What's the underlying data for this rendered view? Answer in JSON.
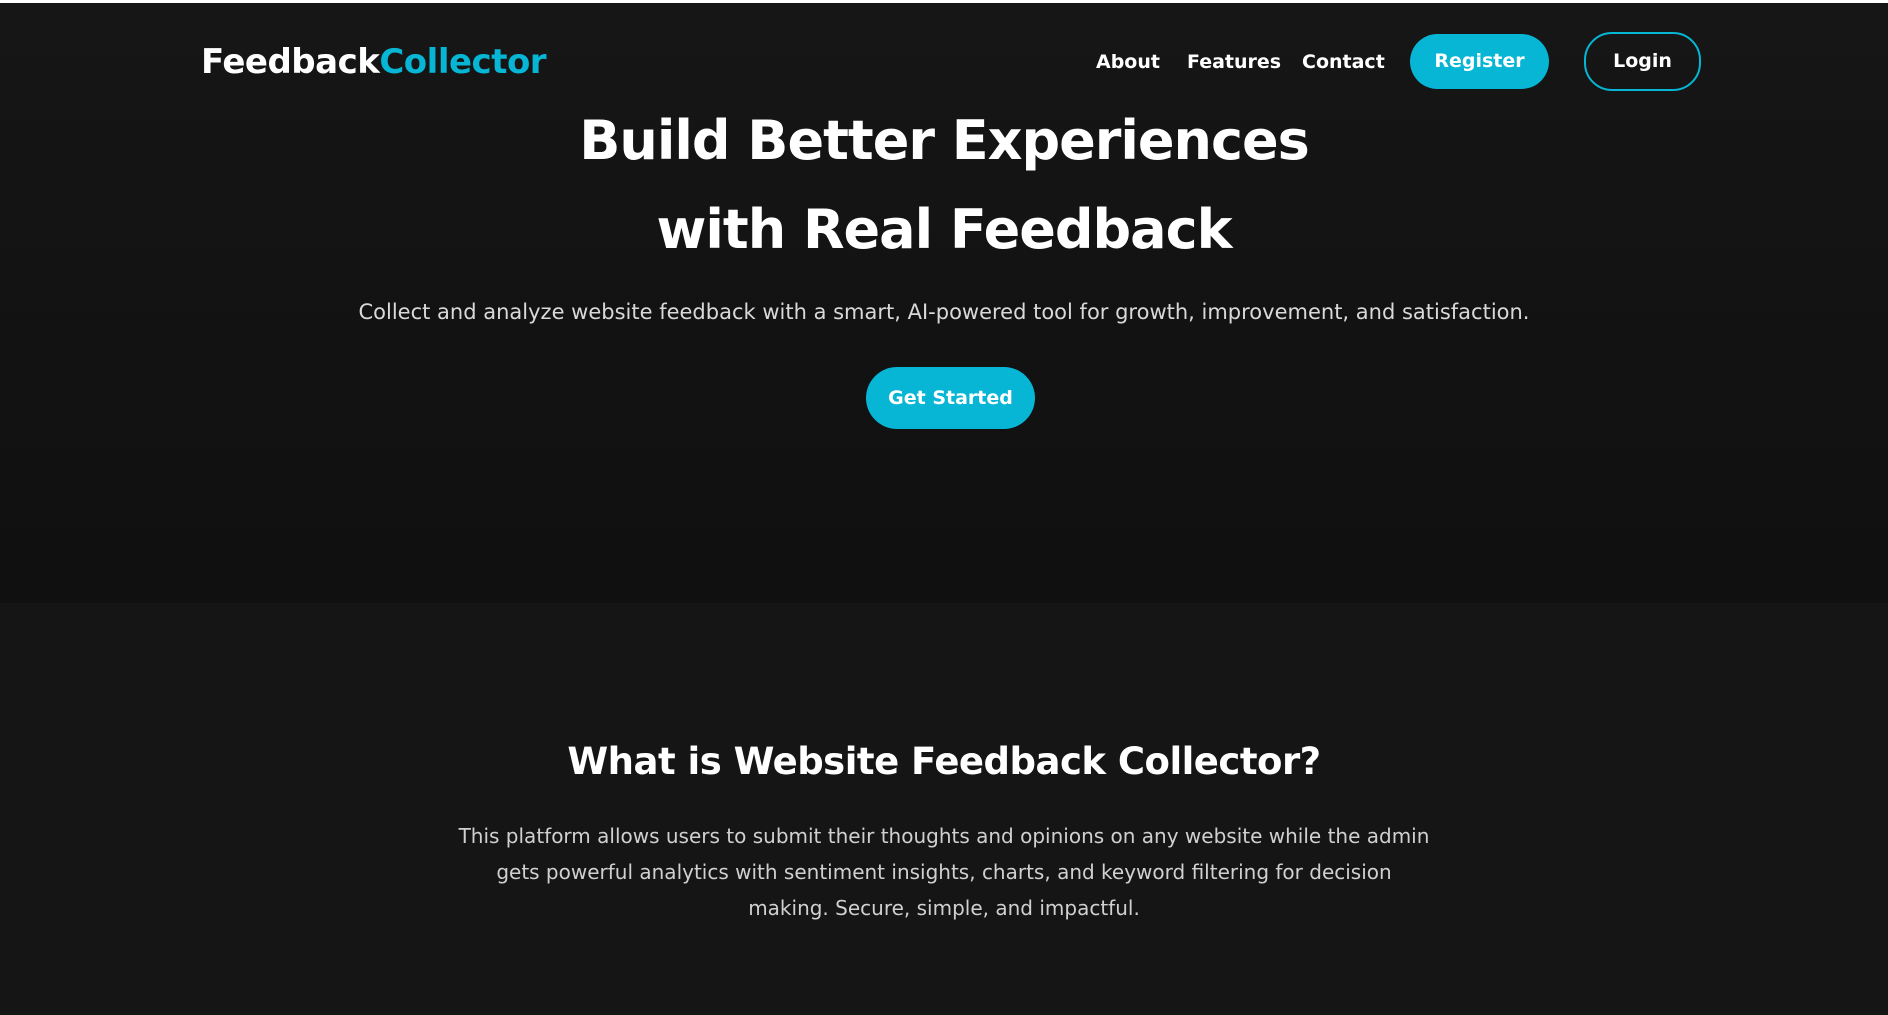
{
  "brand": {
    "part1": "Feedback",
    "part2": "Collector",
    "accent_color": "#06b6d4"
  },
  "nav": {
    "about": "About",
    "features": "Features",
    "contact": "Contact",
    "register": "Register",
    "login": "Login"
  },
  "hero": {
    "title_line1": "Build Better Experiences",
    "title_line2": "with Real Feedback",
    "subtitle": "Collect and analyze website feedback with a smart, AI-powered tool for growth, improvement, and satisfaction.",
    "cta": "Get Started"
  },
  "about_section": {
    "title": "What is Website Feedback Collector?",
    "text": "This platform allows users to submit their thoughts and opinions on any website while the admin gets powerful analytics with sentiment insights, charts, and keyword filtering for decision making. Secure, simple, and impactful."
  }
}
